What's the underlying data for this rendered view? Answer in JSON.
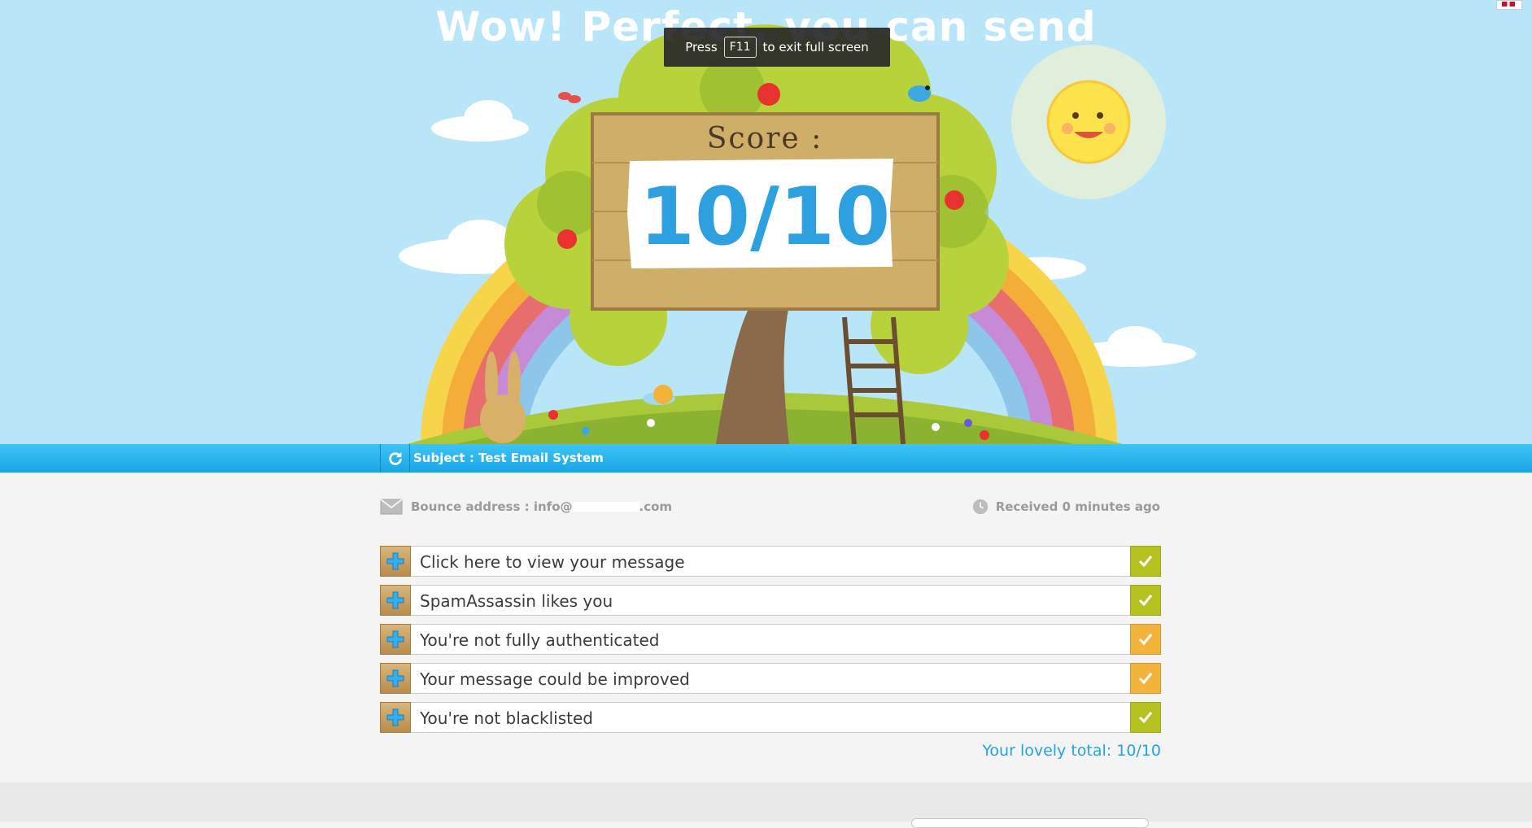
{
  "hero": {
    "title": "Wow! Perfect, you can send",
    "score_label": "Score :",
    "score_value": "10/10"
  },
  "fullscreen_toast": {
    "press": "Press",
    "key": "F11",
    "rest": "to exit full screen"
  },
  "subject": {
    "text": "Subject : Test Email System"
  },
  "meta": {
    "bounce": "Bounce address : info@",
    "bounce_domain_suffix": ".com",
    "received": "Received 0 minutes ago"
  },
  "checks": [
    {
      "label": "Click here to view your message",
      "status": "ok",
      "color": "#b5c21f"
    },
    {
      "label": "SpamAssassin likes you",
      "status": "ok",
      "color": "#b5c21f"
    },
    {
      "label": "You're not fully authenticated",
      "status": "warning",
      "color": "#f2b43a"
    },
    {
      "label": "Your message could be improved",
      "status": "warning",
      "color": "#f2b43a"
    },
    {
      "label": "You're not blacklisted",
      "status": "ok",
      "color": "#b5c21f"
    }
  ],
  "total": "Your lovely total: 10/10",
  "colors": {
    "sky": "#b8e6f8",
    "accent_blue": "#23a3e0",
    "ok_green": "#b5c21f",
    "warn_orange": "#f2b43a"
  },
  "icons": {
    "refresh": "refresh-icon",
    "envelope": "envelope-icon",
    "clock": "clock-icon",
    "expand": "plus-icon",
    "check": "check-icon"
  }
}
